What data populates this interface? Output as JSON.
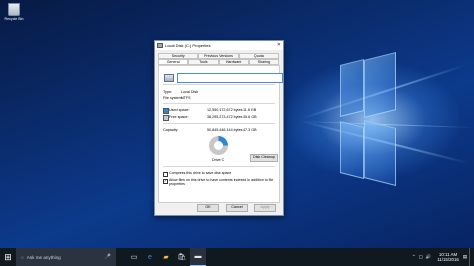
{
  "desktop": {
    "icon_label": "Recycle Bin"
  },
  "dialog": {
    "title": "Local Disk (C:) Properties",
    "close": "✕",
    "tabs_row1": [
      "Security",
      "Previous Versions",
      "Quota"
    ],
    "tabs_row2": [
      "General",
      "Tools",
      "Hardware",
      "Sharing"
    ],
    "active_tab": "General",
    "name_value": "",
    "type_label": "Type:",
    "type_value": "Local Disk",
    "fs_label": "File system:",
    "fs_value": "NTFS",
    "used_label": "Used space:",
    "used_bytes": "12,550,172,672 bytes",
    "used_gb": "11.6 GB",
    "free_label": "Free space:",
    "free_bytes": "38,295,273,472 bytes",
    "free_gb": "35.6 GB",
    "capacity_label": "Capacity:",
    "capacity_bytes": "50,845,446,144 bytes",
    "capacity_gb": "47.3 GB",
    "used_fraction": 0.247,
    "drive_label": "Drive C",
    "cleanup_button": "Disk Cleanup",
    "compress_label": "Compress this drive to save disk space",
    "compress_checked": false,
    "index_label": "Allow files on this drive to have contents indexed in addition to file properties",
    "index_checked": true,
    "ok": "OK",
    "cancel": "Cancel",
    "apply": "Apply",
    "colors": {
      "used": "#2e86d6",
      "free": "#c8c8c8"
    }
  },
  "taskbar": {
    "search_placeholder": "Ask me anything",
    "icons": [
      "task-view-icon",
      "edge-icon",
      "file-explorer-icon",
      "store-icon",
      "drive-icon"
    ],
    "time": "10:11 AM",
    "date": "11/15/2016"
  }
}
